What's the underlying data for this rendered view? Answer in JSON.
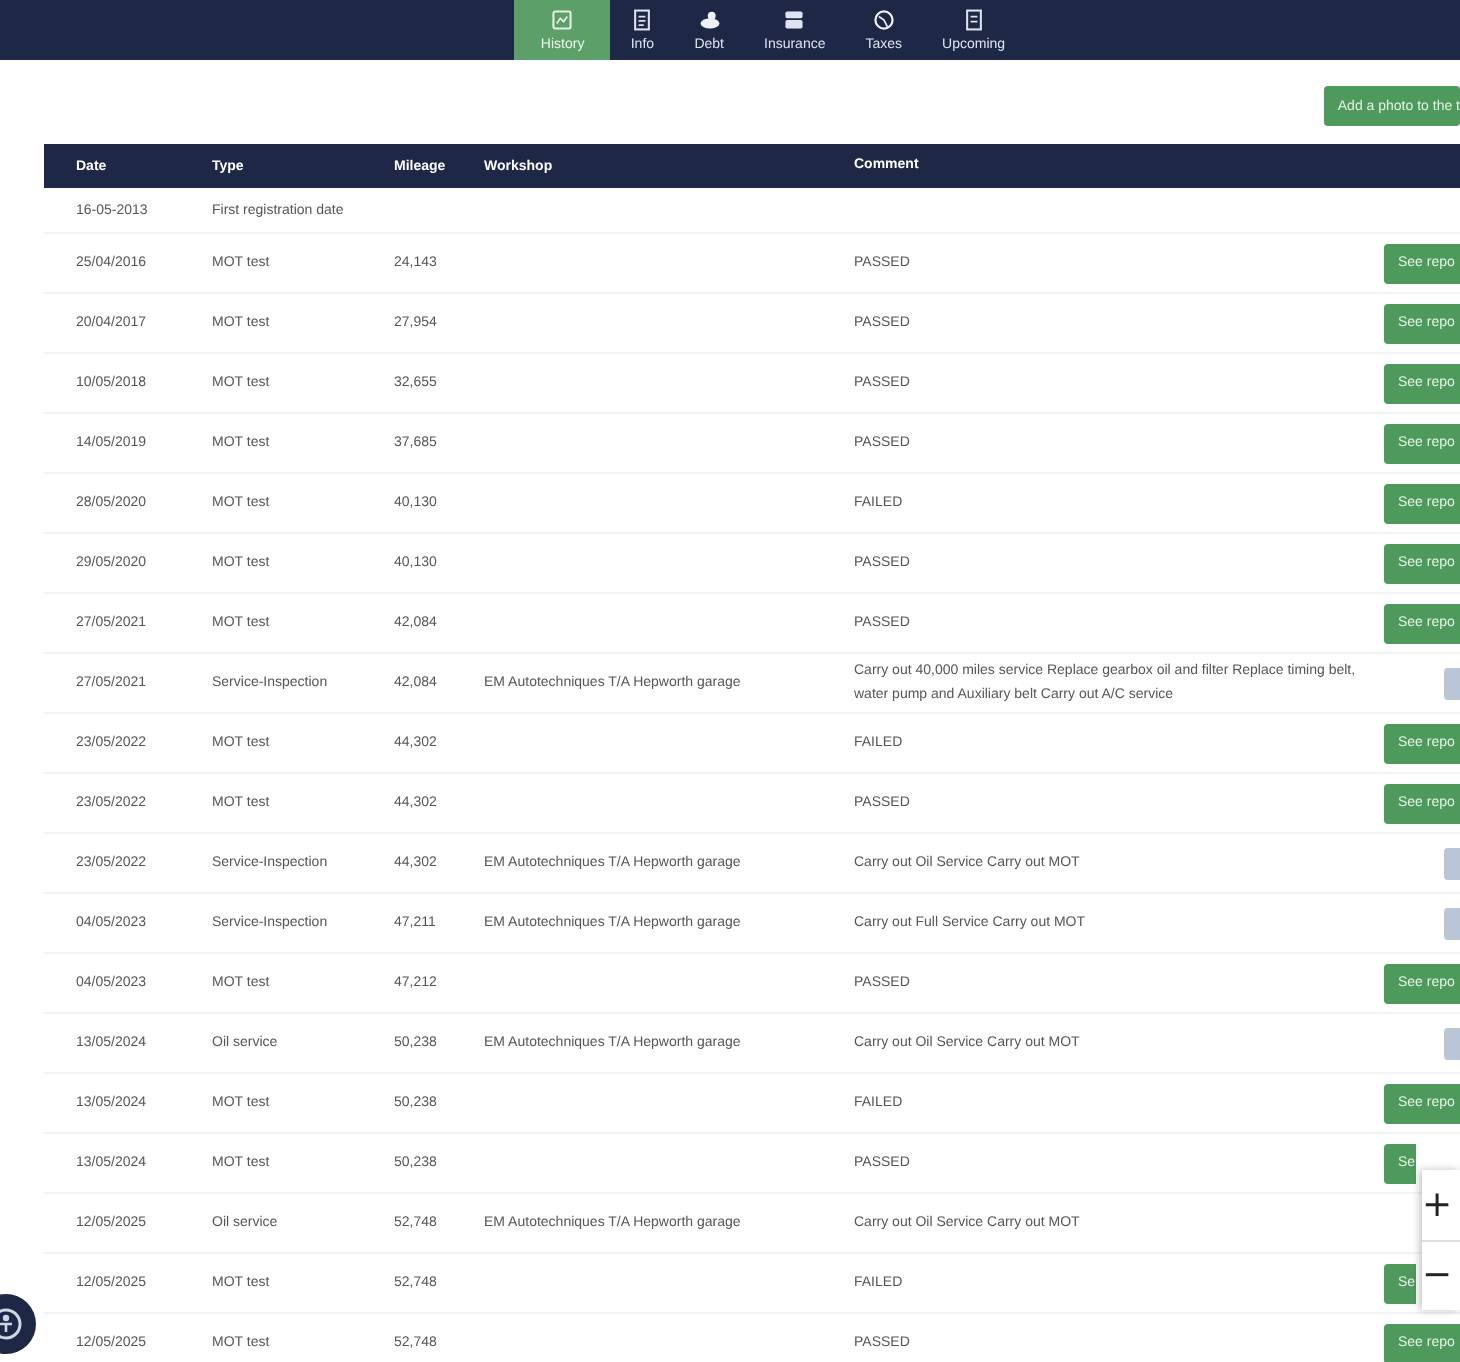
{
  "tabs": [
    {
      "label": "History",
      "selected": true
    },
    {
      "label": "Info",
      "selected": false
    },
    {
      "label": "Debt",
      "selected": false
    },
    {
      "label": "Insurance",
      "selected": false
    },
    {
      "label": "Taxes",
      "selected": false
    },
    {
      "label": "Upcoming",
      "selected": false
    }
  ],
  "add_photo_button": "Add a photo to the t",
  "table": {
    "columns": [
      "Date",
      "Type",
      "Mileage",
      "Workshop",
      "Comment"
    ],
    "rows": [
      {
        "date": "16-05-2013",
        "type": "First registration date",
        "mileage": "",
        "workshop": "",
        "comment": "",
        "kind": "none"
      },
      {
        "date": "25/04/2016",
        "type": "MOT test",
        "mileage": "24,143",
        "workshop": "",
        "comment": "PASSED",
        "kind": "report",
        "label": "See repo"
      },
      {
        "date": "20/04/2017",
        "type": "MOT test",
        "mileage": "27,954",
        "workshop": "",
        "comment": "PASSED",
        "kind": "report",
        "label": "See repo"
      },
      {
        "date": "10/05/2018",
        "type": "MOT test",
        "mileage": "32,655",
        "workshop": "",
        "comment": "PASSED",
        "kind": "report",
        "label": "See repo"
      },
      {
        "date": "14/05/2019",
        "type": "MOT test",
        "mileage": "37,685",
        "workshop": "",
        "comment": "PASSED",
        "kind": "report",
        "label": "See repo"
      },
      {
        "date": "28/05/2020",
        "type": "MOT test",
        "mileage": "40,130",
        "workshop": "",
        "comment": "FAILED",
        "kind": "report",
        "label": "See repo"
      },
      {
        "date": "29/05/2020",
        "type": "MOT test",
        "mileage": "40,130",
        "workshop": "",
        "comment": "PASSED",
        "kind": "report",
        "label": "See repo"
      },
      {
        "date": "27/05/2021",
        "type": "MOT test",
        "mileage": "42,084",
        "workshop": "",
        "comment": "PASSED",
        "kind": "report",
        "label": "See repo"
      },
      {
        "date": "27/05/2021",
        "type": "Service-Inspection",
        "mileage": "42,084",
        "workshop": "EM Autotechniques T/A Hepworth garage",
        "comment": "Carry out 40,000 miles service Replace gearbox oil and filter Replace timing belt, water pump and Auxiliary belt Carry out A/C service",
        "kind": "details"
      },
      {
        "date": "23/05/2022",
        "type": "MOT test",
        "mileage": "44,302",
        "workshop": "",
        "comment": "FAILED",
        "kind": "report",
        "label": "See repo"
      },
      {
        "date": "23/05/2022",
        "type": "MOT test",
        "mileage": "44,302",
        "workshop": "",
        "comment": "PASSED",
        "kind": "report",
        "label": "See repo"
      },
      {
        "date": "23/05/2022",
        "type": "Service-Inspection",
        "mileage": "44,302",
        "workshop": "EM Autotechniques T/A Hepworth garage",
        "comment": "Carry out Oil Service Carry out MOT",
        "kind": "details"
      },
      {
        "date": "04/05/2023",
        "type": "Service-Inspection",
        "mileage": "47,211",
        "workshop": "EM Autotechniques T/A Hepworth garage",
        "comment": "Carry out Full Service Carry out MOT",
        "kind": "details"
      },
      {
        "date": "04/05/2023",
        "type": "MOT test",
        "mileage": "47,212",
        "workshop": "",
        "comment": "PASSED",
        "kind": "report",
        "label": "See repo"
      },
      {
        "date": "13/05/2024",
        "type": "Oil service",
        "mileage": "50,238",
        "workshop": "EM Autotechniques T/A Hepworth garage",
        "comment": "Carry out Oil Service Carry out MOT",
        "kind": "details"
      },
      {
        "date": "13/05/2024",
        "type": "MOT test",
        "mileage": "50,238",
        "workshop": "",
        "comment": "FAILED",
        "kind": "report",
        "label": "See repo"
      },
      {
        "date": "13/05/2024",
        "type": "MOT test",
        "mileage": "50,238",
        "workshop": "",
        "comment": "PASSED",
        "kind": "report",
        "label": "Se"
      },
      {
        "date": "12/05/2025",
        "type": "Oil service",
        "mileage": "52,748",
        "workshop": "EM Autotechniques T/A Hepworth garage",
        "comment": "Carry out Oil Service Carry out MOT",
        "kind": "none"
      },
      {
        "date": "12/05/2025",
        "type": "MOT test",
        "mileage": "52,748",
        "workshop": "",
        "comment": "FAILED",
        "kind": "report",
        "label": "Se"
      },
      {
        "date": "12/05/2025",
        "type": "MOT test",
        "mileage": "52,748",
        "workshop": "",
        "comment": "PASSED",
        "kind": "report",
        "label": "See repo"
      }
    ]
  },
  "zoom_controls": {
    "zoom_in": "+",
    "zoom_out": "−"
  }
}
